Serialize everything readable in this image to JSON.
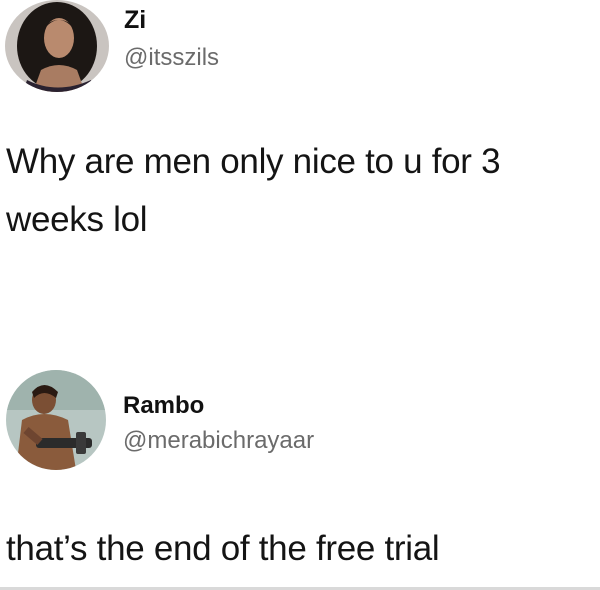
{
  "tweets": [
    {
      "display_name": "Zi",
      "handle": "@itsszils",
      "text": "Why are men only nice to u for 3 weeks lol",
      "avatar_icon": "profile-photo-icon"
    },
    {
      "display_name": "Rambo",
      "handle": "@merabichrayaar",
      "text": "that’s the end of the free trial",
      "avatar_icon": "profile-photo-icon"
    }
  ],
  "colors": {
    "background": "#ffffff",
    "text": "#141414",
    "handle": "#6b6b6b"
  }
}
